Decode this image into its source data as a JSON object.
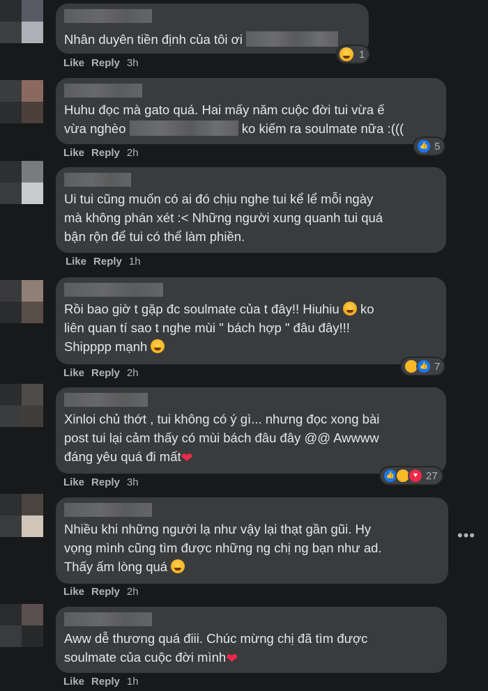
{
  "comments": [
    {
      "text_pre": "Nhân duyên tiền định của tôi ơi ",
      "reaction_count": "1",
      "like": "Like",
      "reply": "Reply",
      "time": "3h"
    },
    {
      "line1": "Huhu đọc mà gato quá. Hai mấy năm cuộc đời tui vừa ế",
      "line2_pre": "vừa nghèo ",
      "line2_post": " ko kiếm ra soulmate nữa :(((",
      "reaction_count": "5",
      "like": "Like",
      "reply": "Reply",
      "time": "2h"
    },
    {
      "text": "Ui tui cũng muốn có ai đó chịu nghe tui kể lể mỗi ngày\nmà không phán xét :< Những người xung quanh tui quá\nbận rộn để tui có thể làm phiền.",
      "like": "Like",
      "reply": "Reply",
      "time": "1h"
    },
    {
      "line1": "Rồi bao giờ t gặp đc soulmate của t đây!! Hiuhiu ",
      "line1_post": " ko",
      "line2": "liên quan tí sao t nghe mùi \" bách hợp \" đâu đây!!!",
      "line3": "Shipppp mạnh ",
      "reaction_count": "7",
      "like": "Like",
      "reply": "Reply",
      "time": "2h"
    },
    {
      "text": "Xinloi chủ thớt , tui không có ý gì... nhưng đọc xong bài\npost tui lại cảm thấy có mùi bách đâu đây @@ Awwww\nđáng yêu quá đi mất",
      "reaction_count": "27",
      "like": "Like",
      "reply": "Reply",
      "time": "3h"
    },
    {
      "text": "Nhiều khi những người lạ như vậy lại thạt gần gũi. Hy\nvọng mình cũng tìm được những ng chị ng bạn như ad.\nThấy ấm lòng quá ",
      "like": "Like",
      "reply": "Reply",
      "time": "2h"
    },
    {
      "text": "Aww dễ thương quá điii. Chúc mừng chị đã tìm được\nsoulmate của cuộc đời mình",
      "like": "Like",
      "reply": "Reply",
      "time": "1h"
    }
  ],
  "more_label": "•••",
  "heart_glyph": "❤",
  "colors": {
    "background": "#18191a",
    "bubble": "#3a3b3c",
    "like": "#1877f2",
    "heart": "#f02849"
  },
  "icons": [
    "grin-squint-emoji",
    "like-icon",
    "crying-emoji",
    "heart-eyes-emoji",
    "haha-icon",
    "heart-icon",
    "sad-emoji",
    "more-options-icon"
  ]
}
